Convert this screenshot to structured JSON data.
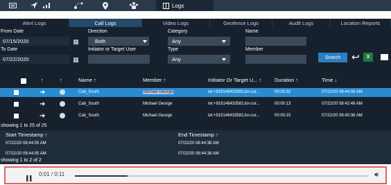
{
  "topbar": {
    "icons": [
      "message-icon",
      "navigate-icon",
      "signal-icon",
      "route-icon",
      "location-icon",
      "people-icon"
    ],
    "active_tab": "Logs"
  },
  "tabs": [
    "Alert Logs",
    "Call Logs",
    "Video Logs",
    "Geofence Logs",
    "Audit Logs",
    "Location Reports"
  ],
  "filters": {
    "from_date_label": "From Date",
    "from_date_value": "07/15/2020",
    "to_date_label": "To Date",
    "to_date_value": "07/22/2020",
    "direction_label": "Direction",
    "direction_value": "Both",
    "initiator_label": "Initiator or Target User",
    "initiator_value": "",
    "category_label": "Category",
    "category_value": "Any",
    "type_label": "Type",
    "type_value": "Any",
    "name_label": "Name",
    "name_value": "",
    "member_label": "Member",
    "member_value": "",
    "search_label": "Search"
  },
  "grid": {
    "headers": {
      "h1": "↑",
      "h2": "↑",
      "name": "Name ↑",
      "member": "Member ↑",
      "initiator": "Initiator Or Target U... ↑",
      "duration": "Duration ↑",
      "time": "Time ↓"
    },
    "rows": [
      {
        "name": "Cab_South",
        "member": "Michael George",
        "initiator": "tel:+919146433581;kn-cor...",
        "duration": "00:00:32",
        "time": "07/22/20 08:44:05 AM"
      },
      {
        "name": "Cab_South",
        "member": "Michael George",
        "initiator": "tel:+919146433581;kn-cor...",
        "duration": "00:00:13",
        "time": "07/22/20 08:42:49 AM"
      },
      {
        "name": "Cab_South",
        "member": "Michael George",
        "initiator": "tel:+919146433581;kn-cor...",
        "duration": "00:00:15",
        "time": "07/22/20 08:40:36 AM"
      }
    ],
    "showing": "showing 1 to 25 of 25"
  },
  "sub": {
    "start_header": "Start Timestamp ↑",
    "end_header": "End Timestamp ↑",
    "rows": [
      {
        "start": "07/22/20 08:44:05 AM",
        "end": "07/22/20 08:44:38 AM"
      },
      {
        "start": "07/22/20 08:44:05 AM",
        "end": "07/22/20 08:44:38 AM"
      }
    ],
    "showing": "showing 1 to 2 of 2"
  },
  "player": {
    "time": "0:01 / 0:11",
    "progress": 0.18,
    "colors": {
      "border": "#e06060",
      "track": "#c8c8c8",
      "fill": "#333333"
    }
  },
  "colors": {
    "accent": "#2a8bd0",
    "dark_bg": "#17212d",
    "search_button": "#2c7fc2"
  }
}
